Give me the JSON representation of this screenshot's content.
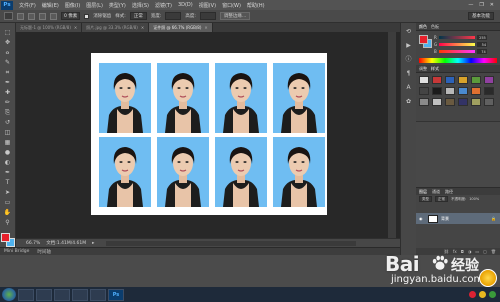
{
  "app": {
    "logo": "Ps"
  },
  "menubar": {
    "items": [
      "文件(F)",
      "编辑(E)",
      "图像(I)",
      "图层(L)",
      "类型(Y)",
      "选择(S)",
      "滤镜(T)",
      "3D(D)",
      "视图(V)",
      "窗口(W)",
      "帮助(H)"
    ],
    "window_controls": [
      "—",
      "❐",
      "✕"
    ]
  },
  "optbar": {
    "feather_value": "0 像素",
    "antialias_label": "消除锯齿",
    "style_label": "样式:",
    "style_value": "正常",
    "width_label": "宽度:",
    "height_label": "高度:",
    "refine_edge_label": "调整边缘...",
    "workspace": "基本功能"
  },
  "tabs": [
    {
      "label": "无标题-1 @ 100% (RGB/8)",
      "active": false
    },
    {
      "label": "照片.jpg @ 33.3% (RGB/8)",
      "active": false
    },
    {
      "label": "证件照 @ 66.7% (RGB/8)",
      "active": true
    }
  ],
  "tools": [
    "marquee-tool",
    "move-tool",
    "lasso-tool",
    "quick-select-tool",
    "crop-tool",
    "eyedropper-tool",
    "healing-tool",
    "brush-tool",
    "clone-tool",
    "history-brush-tool",
    "eraser-tool",
    "gradient-tool",
    "blur-tool",
    "dodge-tool",
    "pen-tool",
    "type-tool",
    "path-select-tool",
    "shape-tool",
    "hand-tool",
    "zoom-tool"
  ],
  "tool_glyphs": [
    "⬚",
    "✥",
    "ⴰ",
    "✎",
    "⌗",
    "✒",
    "✚",
    "✏",
    "⎘",
    "↺",
    "◫",
    "▦",
    "●",
    "◐",
    "✒",
    "T",
    "➤",
    "▭",
    "✋",
    "⚲"
  ],
  "colors": {
    "foreground": "#e8202b",
    "background": "#4fb2ee",
    "accent": "#4fb2ee"
  },
  "status": {
    "zoom": "66.7%",
    "doc_size": "文档:1.41M/4.61M"
  },
  "timeline": {
    "items": [
      "Mini Bridge",
      "时间轴"
    ]
  },
  "dock": {
    "icons": [
      "history-icon",
      "actions-icon",
      "info-icon",
      "paragraph-icon",
      "character-icon",
      "brush-presets-icon"
    ],
    "glyphs": [
      "⟲",
      "▶",
      "ⓘ",
      "¶",
      "A",
      "✿"
    ]
  },
  "color_panel": {
    "tabs": [
      "颜色",
      "色板"
    ],
    "sliders": [
      {
        "label": "R",
        "value": "255"
      },
      {
        "label": "G",
        "value": "54"
      },
      {
        "label": "B",
        "value": "74"
      }
    ]
  },
  "styles_panel": {
    "tabs": [
      "调整",
      "样式"
    ],
    "swatch_colors": [
      "#e0e0e0",
      "#c73838",
      "#2c62b8",
      "#d8a32a",
      "#5b9a3b",
      "#9040a0",
      "#444444",
      "#1b1b1b",
      "#b8b8b8",
      "#4a8ad0",
      "#e07030",
      "#2a2a2a",
      "#8a8a8a",
      "#c0c0c0",
      "#6a5a40",
      "#333366",
      "#a0a060",
      "#606060"
    ]
  },
  "layers_panel": {
    "tabs": [
      "图层",
      "通道",
      "路径"
    ],
    "kind_label": "类型",
    "blend_mode": "正常",
    "opacity_label": "不透明度:",
    "opacity_value": "100%",
    "layer_name": "背景",
    "footer_icons": [
      "link-icon",
      "fx-icon",
      "mask-icon",
      "adjustment-icon",
      "folder-icon",
      "new-layer-icon",
      "trash-icon"
    ],
    "footer_glyphs": [
      "⛓",
      "fx",
      "◘",
      "◑",
      "▭",
      "▢",
      "🗑"
    ]
  },
  "watermark": {
    "brand": "Bai",
    "brand_suffix": "经验",
    "url": "jingyan.baidu.com"
  },
  "taskbar": {
    "ps_label": "Ps"
  }
}
